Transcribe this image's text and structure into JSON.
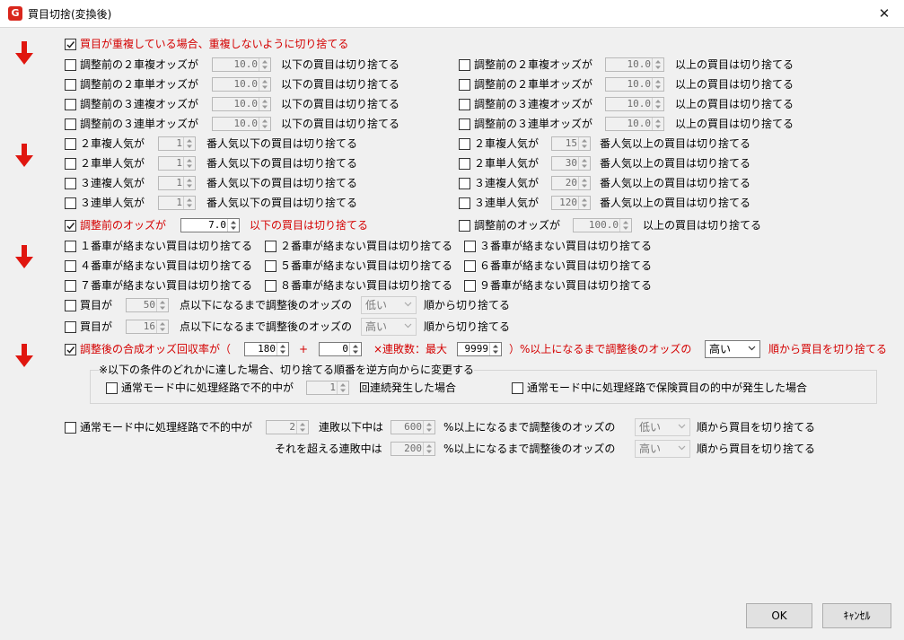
{
  "window": {
    "title": "買目切捨(変換後)",
    "close_glyph": "✕",
    "app_icon_letter": "G"
  },
  "colors": {
    "accent_red": "#d40000",
    "arrow_red": "#e0160f"
  },
  "dedupe": {
    "label": "買目が重複している場合、重複しないように切り捨てる",
    "checked": true
  },
  "odds_rows": [
    {
      "left": {
        "label": "調整前の２車複オッズが",
        "value": "10.0",
        "suffix": "以下の買目は切り捨てる"
      },
      "right": {
        "label": "調整前の２車複オッズが",
        "value": "10.0",
        "suffix": "以上の買目は切り捨てる"
      }
    },
    {
      "left": {
        "label": "調整前の２車単オッズが",
        "value": "10.0",
        "suffix": "以下の買目は切り捨てる"
      },
      "right": {
        "label": "調整前の２車単オッズが",
        "value": "10.0",
        "suffix": "以上の買目は切り捨てる"
      }
    },
    {
      "left": {
        "label": "調整前の３連複オッズが",
        "value": "10.0",
        "suffix": "以下の買目は切り捨てる"
      },
      "right": {
        "label": "調整前の３連複オッズが",
        "value": "10.0",
        "suffix": "以上の買目は切り捨てる"
      }
    },
    {
      "left": {
        "label": "調整前の３連単オッズが",
        "value": "10.0",
        "suffix": "以下の買目は切り捨てる"
      },
      "right": {
        "label": "調整前の３連単オッズが",
        "value": "10.0",
        "suffix": "以上の買目は切り捨てる"
      }
    }
  ],
  "pop_rows": [
    {
      "left": {
        "label": "２車複人気が",
        "value": "1",
        "suffix": "番人気以下の買目は切り捨てる"
      },
      "right": {
        "label": "２車複人気が",
        "value": "15",
        "suffix": "番人気以上の買目は切り捨てる"
      }
    },
    {
      "left": {
        "label": "２車単人気が",
        "value": "1",
        "suffix": "番人気以下の買目は切り捨てる"
      },
      "right": {
        "label": "２車単人気が",
        "value": "30",
        "suffix": "番人気以上の買目は切り捨てる"
      }
    },
    {
      "left": {
        "label": "３連複人気が",
        "value": "1",
        "suffix": "番人気以下の買目は切り捨てる"
      },
      "right": {
        "label": "３連複人気が",
        "value": "20",
        "suffix": "番人気以上の買目は切り捨てる"
      }
    },
    {
      "left": {
        "label": "３連単人気が",
        "value": "1",
        "suffix": "番人気以下の買目は切り捨てる"
      },
      "right": {
        "label": "３連単人気が",
        "value": "120",
        "suffix": "番人気以上の買目は切り捨てる"
      }
    }
  ],
  "pre_odds": {
    "left": {
      "label": "調整前のオッズが",
      "value": "7.0",
      "suffix": "以下の買目は切り捨てる",
      "checked": true
    },
    "right": {
      "label": "調整前のオッズが",
      "value": "100.0",
      "suffix": "以上の買目は切り捨てる",
      "checked": false
    }
  },
  "cars": [
    "１番車が絡まない買目は切り捨てる",
    "２番車が絡まない買目は切り捨てる",
    "３番車が絡まない買目は切り捨てる",
    "４番車が絡まない買目は切り捨てる",
    "５番車が絡まない買目は切り捨てる",
    "６番車が絡まない買目は切り捨てる",
    "７番車が絡まない買目は切り捨てる",
    "８番車が絡まない買目は切り捨てる",
    "９番車が絡まない買目は切り捨てる"
  ],
  "points_rows": [
    {
      "label": "買目が",
      "value": "50",
      "mid": "点以下になるまで調整後のオッズの",
      "select": "低い",
      "suffix": "順から切り捨てる"
    },
    {
      "label": "買目が",
      "value": "16",
      "mid": "点以下になるまで調整後のオッズの",
      "select": "高い",
      "suffix": "順から切り捨てる"
    }
  ],
  "composite": {
    "label": "調整後の合成オッズ回収率が（",
    "value1": "180",
    "plus": "+",
    "value2": "0",
    "mult": "×連敗数：最大",
    "value3": "9999",
    "tail": "）%以上になるまで調整後のオッズの",
    "select": "高い",
    "suffix": "順から買目を切り捨てる",
    "checked": true
  },
  "reverse_group": {
    "title": "※以下の条件のどれかに達した場合、切り捨てる順番を逆方向からに変更する",
    "left": {
      "label": "通常モード中に処理経路で不的中が",
      "value": "1",
      "suffix": "回連続発生した場合"
    },
    "right": {
      "label": "通常モード中に処理経路で保険買目の的中が発生した場合"
    }
  },
  "normal_mode": {
    "label": "通常モード中に処理経路で不的中が",
    "value1": "2",
    "mid1": "連敗以下中は",
    "value2": "600",
    "pct1": "%以上になるまで調整後のオッズの",
    "select1": "低い",
    "suffix": "順から買目を切り捨てる",
    "over_label": "それを超える連敗中は",
    "value3": "200",
    "pct2": "%以上になるまで調整後のオッズの",
    "select2": "高い",
    "suffix2": "順から買目を切り捨てる"
  },
  "buttons": {
    "ok": "OK",
    "cancel": "ｷｬﾝｾﾙ"
  }
}
